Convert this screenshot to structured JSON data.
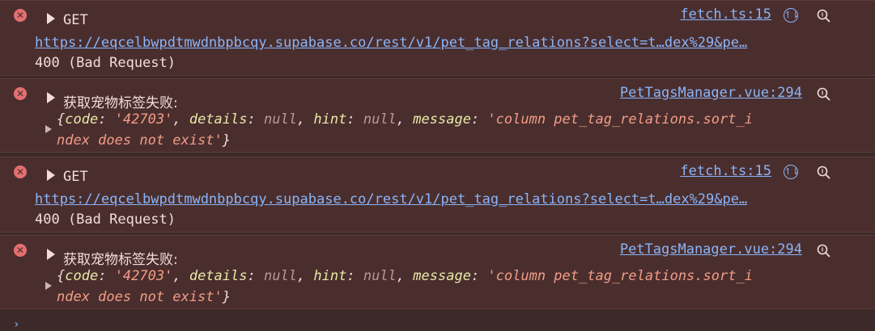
{
  "entries": [
    {
      "type": "network",
      "method": "GET",
      "url": "https://eqcelbwpdtmwdnbpbcqy.supabase.co/rest/v1/pet_tag_relations?select=t…dex%29&pe…",
      "status": "400 (Bad Request)",
      "source": "fetch.ts:15"
    },
    {
      "type": "log",
      "message": "获取宠物标签失败:",
      "source": "PetTagsManager.vue:294",
      "object": {
        "open": "{",
        "code_key": "code",
        "code_val": "'42703'",
        "details_key": "details",
        "details_val": "null",
        "hint_key": "hint",
        "hint_val": "null",
        "message_key": "message",
        "message_val_line1": "'column pet_tag_relations.sort_i",
        "message_val_line2": "ndex does not exist'",
        "close": "}"
      }
    },
    {
      "type": "network",
      "method": "GET",
      "url": "https://eqcelbwpdtmwdnbpbcqy.supabase.co/rest/v1/pet_tag_relations?select=t…dex%29&pe…",
      "status": "400 (Bad Request)",
      "source": "fetch.ts:15"
    },
    {
      "type": "log",
      "message": "获取宠物标签失败:",
      "source": "PetTagsManager.vue:294",
      "object": {
        "open": "{",
        "code_key": "code",
        "code_val": "'42703'",
        "details_key": "details",
        "details_val": "null",
        "hint_key": "hint",
        "hint_val": "null",
        "message_key": "message",
        "message_val_line1": "'column pet_tag_relations.sort_i",
        "message_val_line2": "ndex does not exist'",
        "close": "}"
      }
    }
  ],
  "icons": {
    "error": "error-circle-icon",
    "request_initiator": "request-initiator-icon",
    "search": "search-icon",
    "expand": "expand-triangle-icon"
  },
  "colors": {
    "error_bg": "#4a2e2e",
    "link": "#8ab4f8",
    "string": "#f29c86",
    "key": "#e9e9a8"
  }
}
